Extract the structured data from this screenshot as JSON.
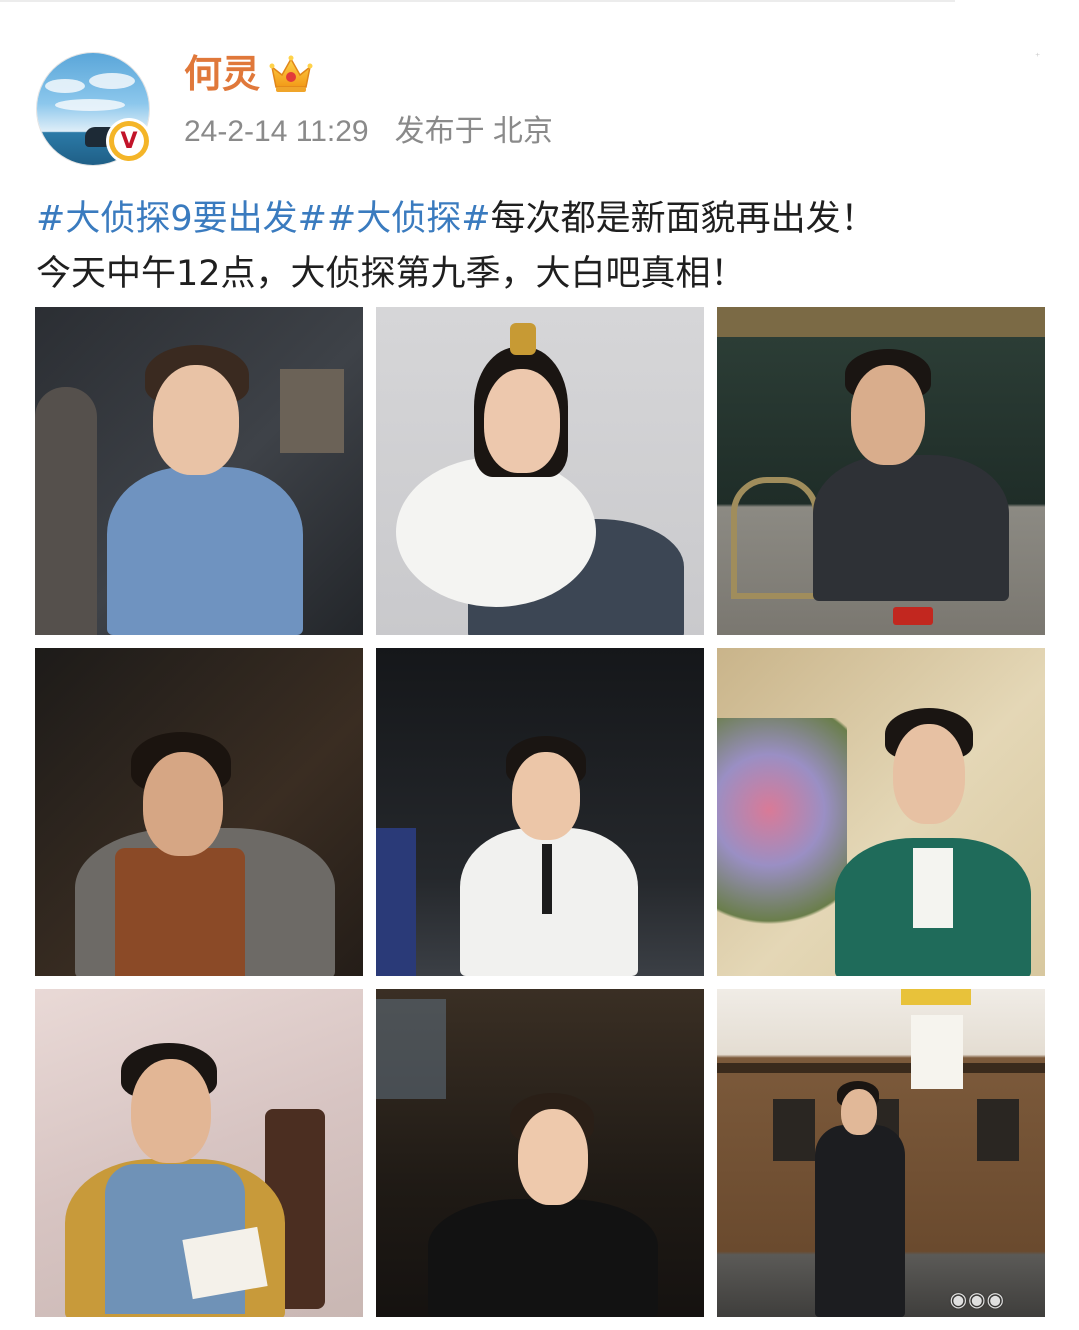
{
  "post": {
    "author": {
      "name": "何灵",
      "verified_badge_letter": "V",
      "badge_icon": "crown-icon"
    },
    "timestamp": "24-2-14 11:29",
    "location_text": "发布于 北京",
    "text": {
      "hashtag_1": "#大侦探9要出发#",
      "hashtag_2": "#大侦探#",
      "line1_rest": "每次都是新面貌再出发！",
      "line2": "今天中午12点，大侦探第九季，大白吧真相！"
    },
    "images": [
      {
        "label": "photo-1-denim-jacket",
        "icon": "photo"
      },
      {
        "label": "photo-2-white-fur-costume",
        "icon": "photo"
      },
      {
        "label": "photo-3-dark-shirt-table",
        "icon": "photo"
      },
      {
        "label": "photo-4-leather-apron",
        "icon": "photo"
      },
      {
        "label": "photo-5-white-uniform",
        "icon": "photo"
      },
      {
        "label": "photo-6-green-velvet-suit",
        "icon": "photo"
      },
      {
        "label": "photo-7-plaid-denim-vest",
        "icon": "photo"
      },
      {
        "label": "photo-8-black-velvet",
        "icon": "photo"
      },
      {
        "label": "photo-9-train-coat",
        "icon": "photo"
      }
    ]
  },
  "colors": {
    "username": "#e0783a",
    "hashtag": "#3a7bbf",
    "meta": "#8a8a8a",
    "badge": "#f4b528"
  }
}
